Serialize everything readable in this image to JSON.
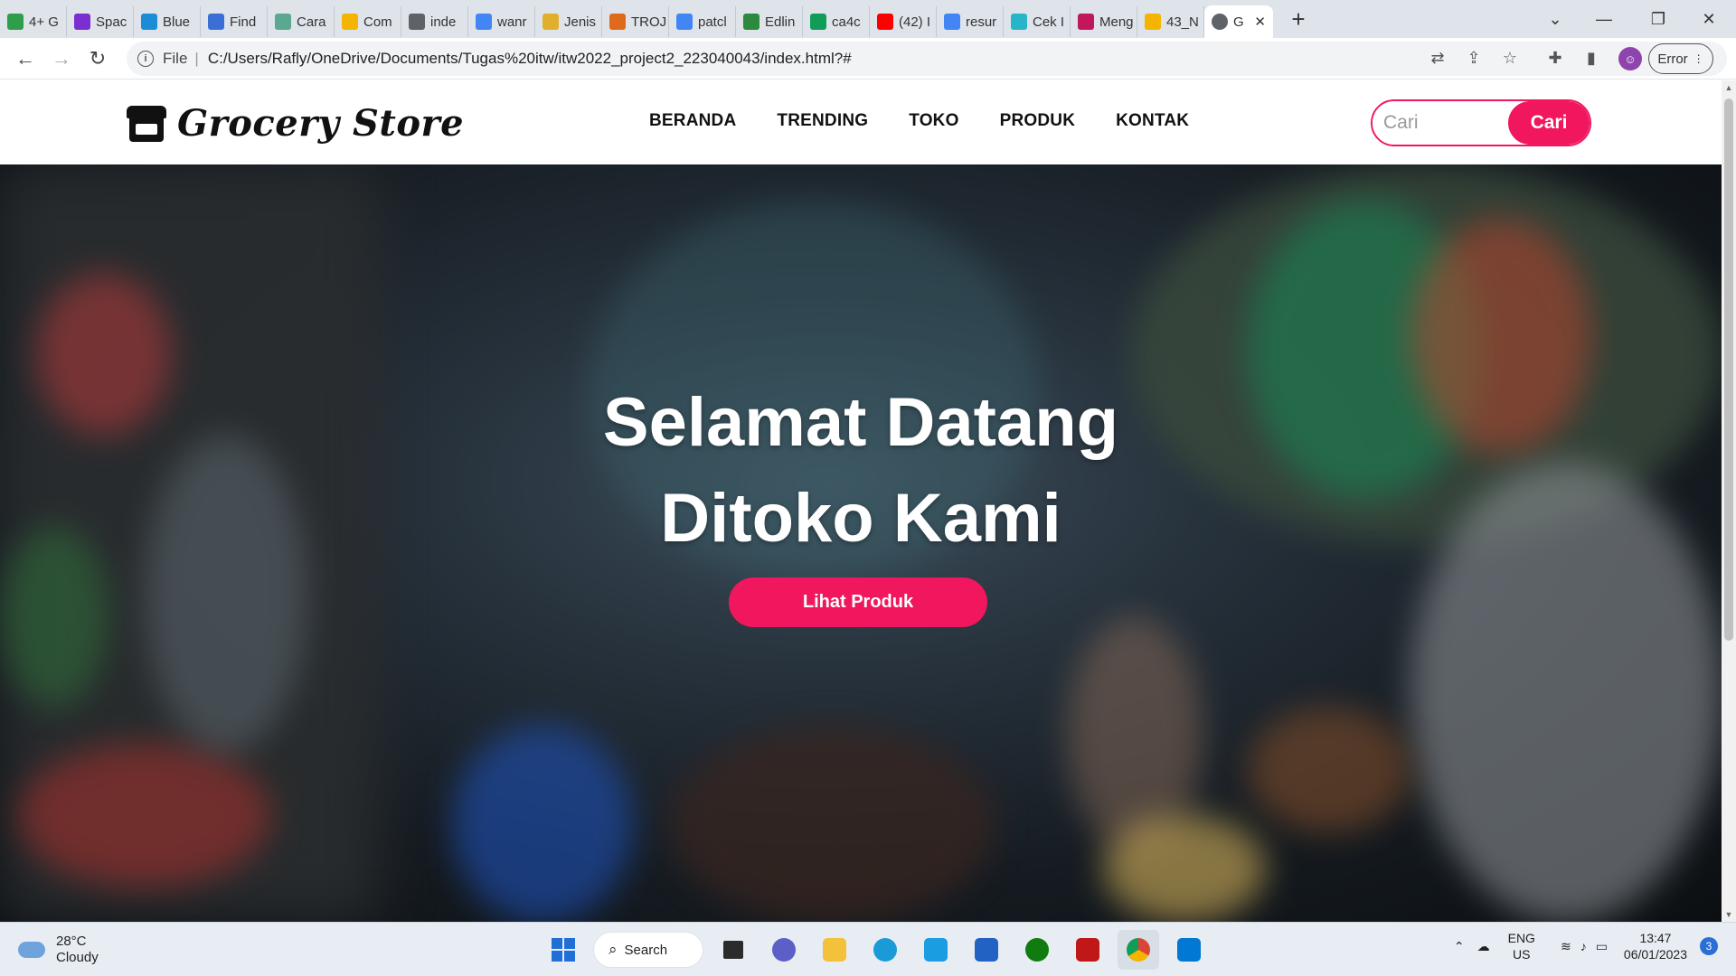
{
  "browser": {
    "tabs": [
      {
        "label": "4+ G",
        "icon": "px-icon",
        "color": "#2e9e4a"
      },
      {
        "label": "Spac",
        "icon": "b-icon",
        "color": "#7b2fd1"
      },
      {
        "label": "Blue",
        "icon": "c-icon",
        "color": "#1a8cd8"
      },
      {
        "label": "Find",
        "icon": "flag-icon",
        "color": "#3c6fd6"
      },
      {
        "label": "Cara",
        "icon": "chatgpt-icon",
        "color": "#5aa88f"
      },
      {
        "label": "Com",
        "icon": "drive-icon",
        "color": "#f4b400"
      },
      {
        "label": "inde",
        "icon": "globe-icon",
        "color": "#5f6368"
      },
      {
        "label": "wanr",
        "icon": "google-icon",
        "color": "#4285f4"
      },
      {
        "label": "Jenis",
        "icon": "shield-icon",
        "color": "#e0b02c"
      },
      {
        "label": "TROJ",
        "icon": "site-icon",
        "color": "#e06a1c"
      },
      {
        "label": "patcl",
        "icon": "google-icon",
        "color": "#4285f4"
      },
      {
        "label": "Edlin",
        "icon": "shield-icon",
        "color": "#2b8a3e"
      },
      {
        "label": "ca4c",
        "icon": "drive-icon",
        "color": "#0f9d58"
      },
      {
        "label": "(42) I",
        "icon": "youtube-icon",
        "color": "#ff0000"
      },
      {
        "label": "resur",
        "icon": "google-icon",
        "color": "#4285f4"
      },
      {
        "label": "Cek I",
        "icon": "c-icon",
        "color": "#28b5c9"
      },
      {
        "label": "Meng",
        "icon": "people-icon",
        "color": "#c2185b"
      },
      {
        "label": "43_N",
        "icon": "drive-icon",
        "color": "#f4b400"
      }
    ],
    "active_tab": {
      "label": "G",
      "icon": "globe-icon"
    },
    "url_scheme": "File",
    "url": "C:/Users/Rafly/OneDrive/Documents/Tugas%20itw/itw2022_project2_223040043/index.html?#",
    "error_label": "Error"
  },
  "site": {
    "brand": "Grocery Store",
    "nav": [
      "BERANDA",
      "TRENDING",
      "TOKO",
      "PRODUK",
      "KONTAK"
    ],
    "search_placeholder": "Cari",
    "search_button": "Cari",
    "hero_line1": "Selamat Datang",
    "hero_line2": "Ditoko Kami",
    "hero_button": "Lihat Produk",
    "accent": "#f0175e"
  },
  "taskbar": {
    "temperature": "28°C",
    "condition": "Cloudy",
    "search_label": "Search",
    "language": "ENG",
    "region": "US",
    "time": "13:47",
    "date": "06/01/2023",
    "notifications": "3"
  }
}
